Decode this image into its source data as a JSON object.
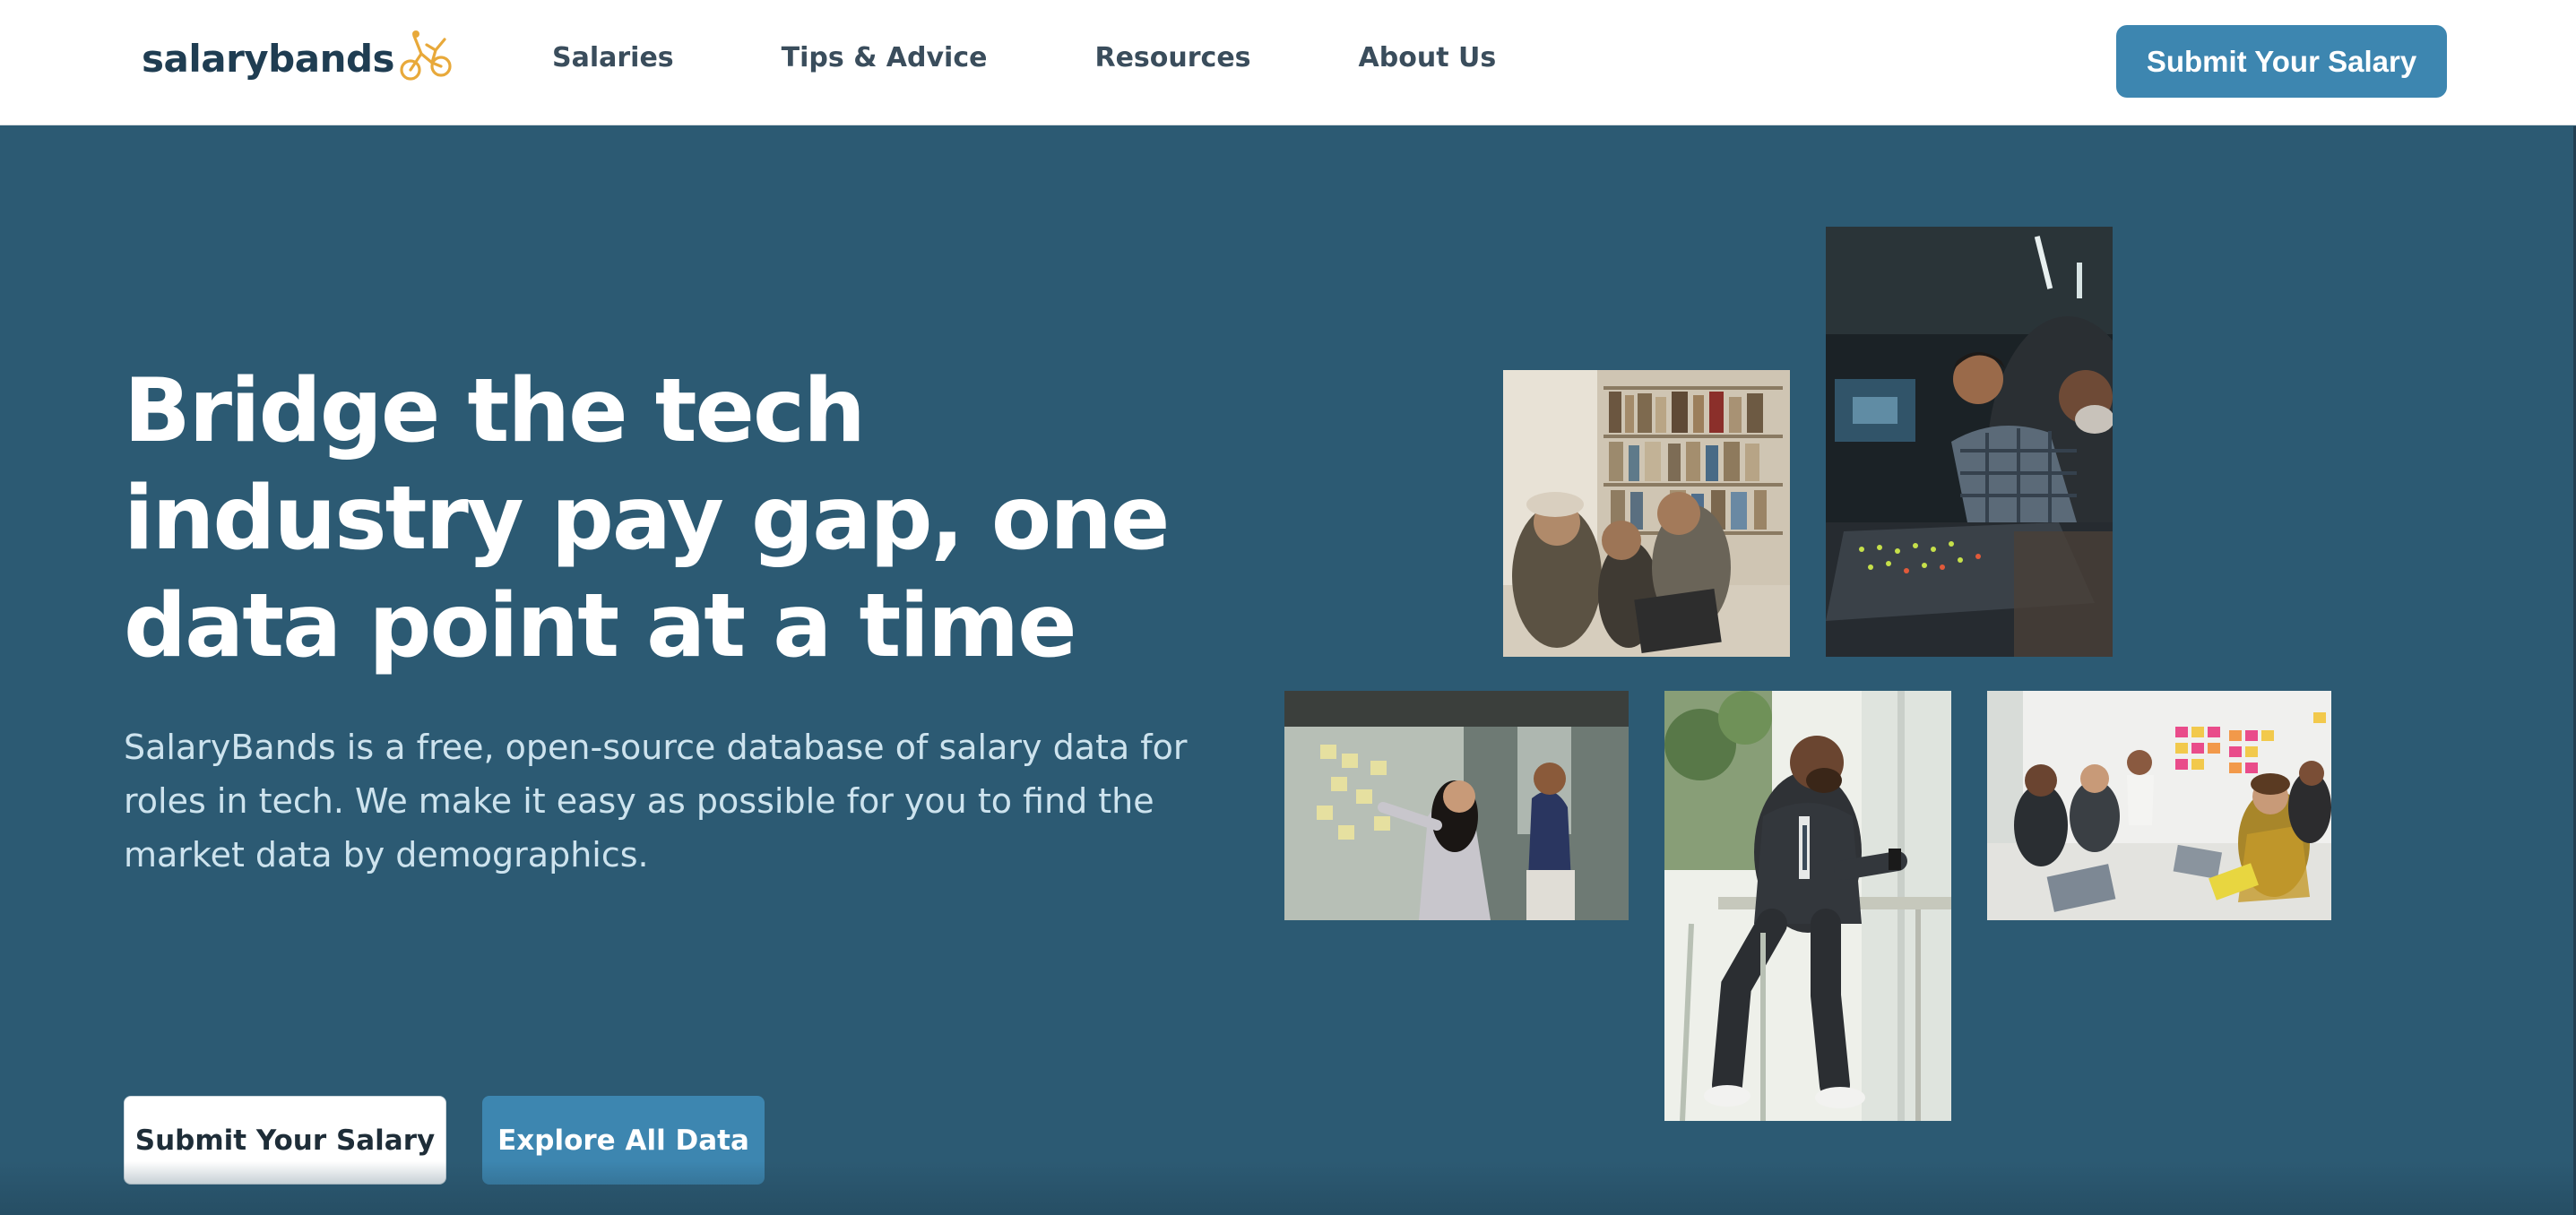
{
  "header": {
    "logo_text": "salarybands",
    "logo_icon": "bicycle-rider-icon",
    "nav": [
      {
        "label": "Salaries"
      },
      {
        "label": "Tips & Advice"
      },
      {
        "label": "Resources"
      },
      {
        "label": "About Us"
      }
    ],
    "cta_label": "Submit Your Salary"
  },
  "hero": {
    "title": "Bridge the tech industry pay gap, one data point at a time",
    "description": "SalaryBands is a free, open-source database of salary data for roles in tech. We make it easy as possible for you to find the market data by demographics.",
    "primary_button": "Submit Your Salary",
    "secondary_button": "Explore All Data"
  },
  "photos": [
    {
      "name": "people-in-library-photo"
    },
    {
      "name": "men-at-control-desk-photo"
    },
    {
      "name": "woman-sticky-notes-glass-photo"
    },
    {
      "name": "man-seated-with-phone-photo"
    },
    {
      "name": "team-meeting-sticky-notes-photo"
    }
  ],
  "colors": {
    "hero_background": "#2c5a73",
    "accent": "#3d86b0",
    "logo_accent": "#e8a93a",
    "heading_text": "#1f3d52"
  }
}
